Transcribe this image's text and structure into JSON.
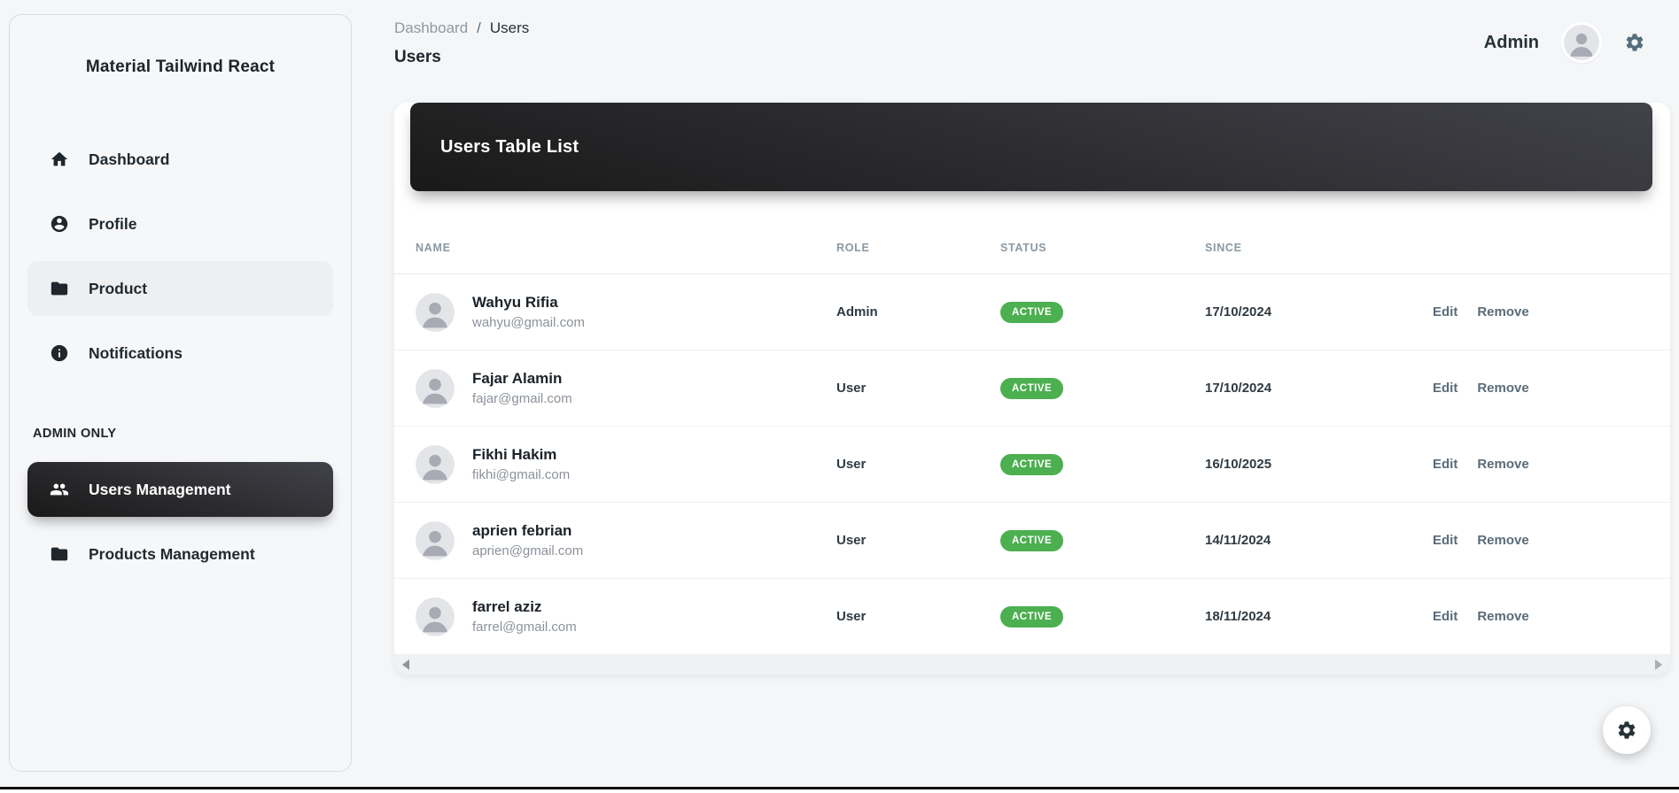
{
  "app": {
    "title": "Material Tailwind React"
  },
  "sidebar": {
    "items": [
      {
        "label": "Dashboard",
        "icon": "home-icon"
      },
      {
        "label": "Profile",
        "icon": "person-icon"
      },
      {
        "label": "Product",
        "icon": "folder-icon",
        "state": "hovered"
      },
      {
        "label": "Notifications",
        "icon": "info-icon"
      }
    ],
    "section_label": "ADMIN ONLY",
    "admin_items": [
      {
        "label": "Users Management",
        "icon": "users-icon",
        "state": "active"
      },
      {
        "label": "Products Management",
        "icon": "folder-icon"
      }
    ]
  },
  "header": {
    "breadcrumb": {
      "parent": "Dashboard",
      "separator": "/",
      "current": "Users"
    },
    "page_title": "Users",
    "user_label": "Admin"
  },
  "card": {
    "title": "Users Table List"
  },
  "table": {
    "columns": {
      "name": "NAME",
      "role": "ROLE",
      "status": "STATUS",
      "since": "SINCE"
    },
    "actions": {
      "edit": "Edit",
      "remove": "Remove"
    },
    "rows": [
      {
        "name": "Wahyu Rifia",
        "email": "wahyu@gmail.com",
        "role": "Admin",
        "status": "ACTIVE",
        "since": "17/10/2024"
      },
      {
        "name": "Fajar Alamin",
        "email": "fajar@gmail.com",
        "role": "User",
        "status": "ACTIVE",
        "since": "17/10/2024"
      },
      {
        "name": "Fikhi Hakim",
        "email": "fikhi@gmail.com",
        "role": "User",
        "status": "ACTIVE",
        "since": "16/10/2025"
      },
      {
        "name": "aprien febrian",
        "email": "aprien@gmail.com",
        "role": "User",
        "status": "ACTIVE",
        "since": "14/11/2024"
      },
      {
        "name": "farrel aziz",
        "email": "farrel@gmail.com",
        "role": "User",
        "status": "ACTIVE",
        "since": "18/11/2024"
      }
    ]
  },
  "colors": {
    "status_active_green": "#4caf50",
    "active_item_gradient_start": "#42424a",
    "active_item_gradient_end": "#191919",
    "accent_bluegray": "#546e7a",
    "page_background": "#f4f6f8"
  }
}
